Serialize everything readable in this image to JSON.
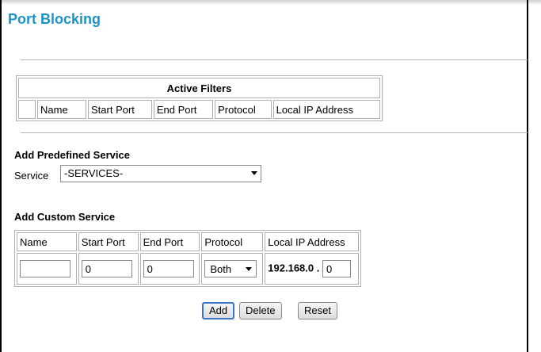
{
  "page_title": "Port Blocking",
  "active_filters": {
    "title": "Active Filters",
    "columns": [
      "",
      "Name",
      "Start Port",
      "End Port",
      "Protocol",
      "Local IP Address"
    ]
  },
  "predefined": {
    "title": "Add Predefined Service",
    "service_label": "Service",
    "service_value": "-SERVICES-"
  },
  "custom": {
    "title": "Add Custom Service",
    "columns": [
      "Name",
      "Start Port",
      "End Port",
      "Protocol",
      "Local IP Address"
    ],
    "name_value": "",
    "start_port": "0",
    "end_port": "0",
    "protocol": "Both",
    "ip_prefix": "192.168.0 .",
    "ip_last": "0"
  },
  "buttons": {
    "add": "Add",
    "delete": "Delete",
    "reset": "Reset"
  }
}
